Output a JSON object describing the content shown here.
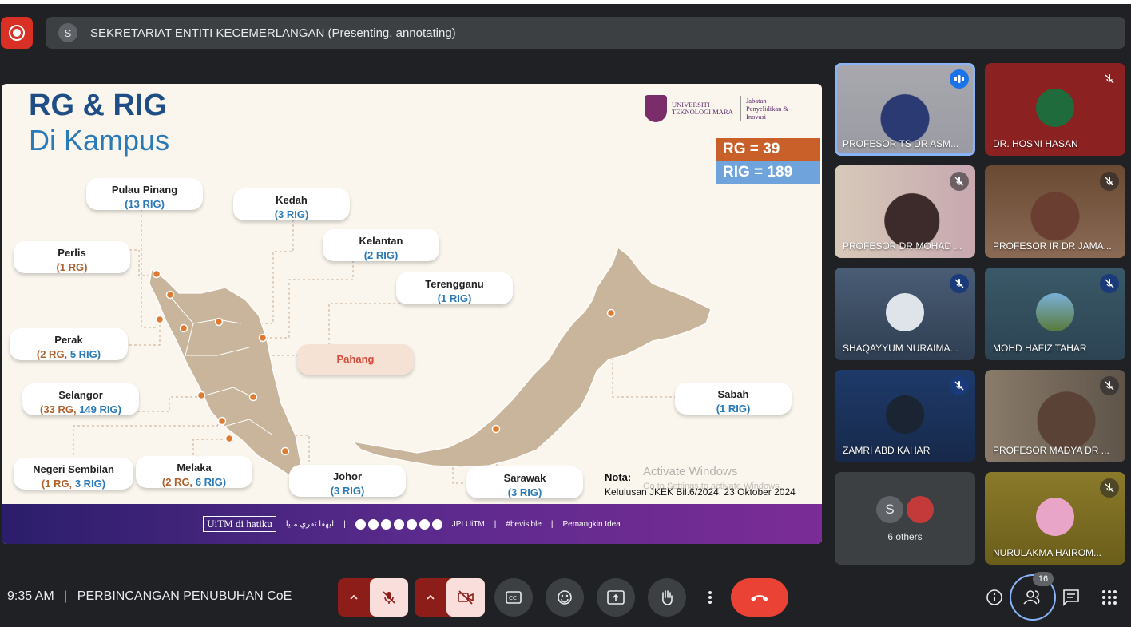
{
  "presenter": {
    "initial": "S",
    "label": "SEKRETARIAT ENTITI KECEMERLANGAN (Presenting, annotating)"
  },
  "slide": {
    "title_line1": "RG & RIG",
    "title_line2": "Di Kampus",
    "logo_university": "UNIVERSITI TEKNOLOGI MARA",
    "logo_dept": "Jabatan Penyelidikan & Inovasi",
    "rg_total": "RG = 39",
    "rig_total": "RIG = 189",
    "states": [
      {
        "name": "Pulau Pinang",
        "rg": "",
        "rig": "(13 RIG)"
      },
      {
        "name": "Kedah",
        "rg": "",
        "rig": "(3 RIG)"
      },
      {
        "name": "Perlis",
        "rg": "(1 RG)",
        "rig": ""
      },
      {
        "name": "Kelantan",
        "rg": "",
        "rig": "(2 RIG)"
      },
      {
        "name": "Terengganu",
        "rg": "",
        "rig": "(1 RIG)"
      },
      {
        "name": "Perak",
        "rg": "(2 RG,",
        "rig": "5 RIG)"
      },
      {
        "name": "Pahang",
        "rg": "",
        "rig": ""
      },
      {
        "name": "Selangor",
        "rg": "(33 RG,",
        "rig": "149 RIG)"
      },
      {
        "name": "Negeri Sembilan",
        "rg": "(1 RG,",
        "rig": "3 RIG)"
      },
      {
        "name": "Melaka",
        "rg": "(2 RG,",
        "rig": "6 RIG)"
      },
      {
        "name": "Johor",
        "rg": "",
        "rig": "(3 RIG)"
      },
      {
        "name": "Sarawak",
        "rg": "",
        "rig": "(3 RIG)"
      },
      {
        "name": "Sabah",
        "rg": "",
        "rig": "(1 RIG)"
      }
    ],
    "nota_label": "Nota:",
    "nota_text": "Kelulusan JKEK Bil.6/2024, 23 Oktober 2024",
    "watermark1": "Activate Windows",
    "watermark2": "Go to Settings to activate Windows.",
    "footer": {
      "brand": "UiTM di hatiku",
      "jawi": "ليهڤا تقري مليا",
      "jpi": "JPI UiTM",
      "hashtag": "#bevisible",
      "tagline": "Pemangkin Idea"
    }
  },
  "participants": [
    {
      "name": "PROFESOR TS DR ASM...",
      "state": "speaking"
    },
    {
      "name": "DR. HOSNI HASAN",
      "state": "muted"
    },
    {
      "name": "PROFESOR DR MOHAD ...",
      "state": "muted"
    },
    {
      "name": "PROFESOR IR DR JAMA...",
      "state": "muted"
    },
    {
      "name": "SHAQAYYUM NURAIMA...",
      "state": "muted"
    },
    {
      "name": "MOHD HAFIZ TAHAR",
      "state": "muted"
    },
    {
      "name": "ZAMRI ABD KAHAR",
      "state": "muted"
    },
    {
      "name": "PROFESOR MADYA DR ...",
      "state": "muted"
    },
    {
      "name": "NURULAKMA HAIROM...",
      "state": "muted"
    }
  ],
  "others": {
    "initial": "S",
    "label": "6 others"
  },
  "meeting": {
    "time": "9:35 AM",
    "title": "PERBINCANGAN PENUBUHAN CoE",
    "participant_count": "16"
  },
  "colors": {
    "accent": "#8ab4f8",
    "end_call": "#ea4335",
    "muted_group": "#8c1d18"
  }
}
